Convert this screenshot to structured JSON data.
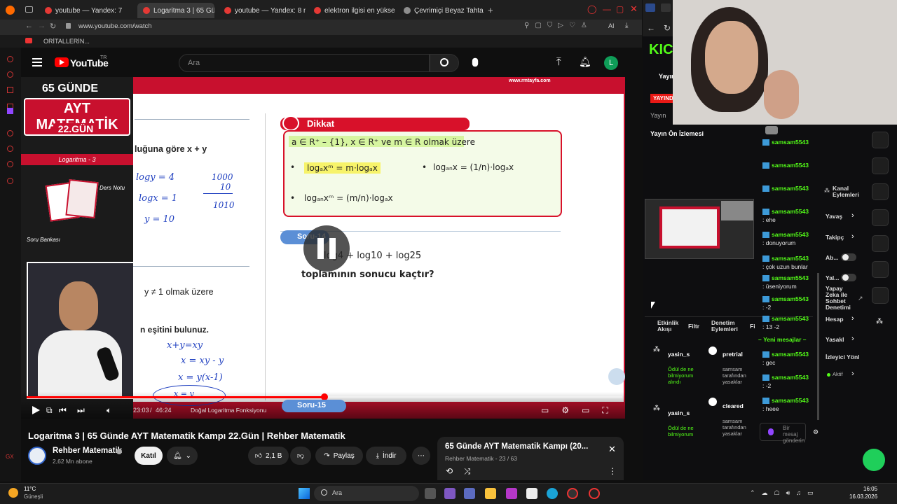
{
  "browser": {
    "tabs": [
      {
        "label": "youtube — Yandex: 7 milyo"
      },
      {
        "label": "Logaritma 3 | 65 Günd"
      },
      {
        "label": "youtube — Yandex: 8 milyo"
      },
      {
        "label": "elektron ilgisi en yüksek ve"
      },
      {
        "label": "Çevrimiçi Beyaz Tahta - Ç"
      }
    ],
    "url": "www.youtube.com/watch",
    "bookmark": "ORİTALLERİN..."
  },
  "youtube": {
    "logo": "YouTube",
    "region": "TR",
    "search_placeholder": "Ara",
    "avatar_letter": "L"
  },
  "video": {
    "badge_top": "65 GÜNDE",
    "badge_main": "AYT MATEMATİK",
    "badge_day": "22.GÜN",
    "topic": "Logaritma - 3",
    "ders_notu": "Ders Notu",
    "soru_bankasi": "Soru Bankası",
    "site": "www.rmtayfa.com",
    "dikkat_title": "Dikkat",
    "cond_line": "a ∈ R⁺ – {1},  x ∈ R⁺ ve m ∈ R olmak üzere",
    "rule1": "logₐxᵐ = m·logₐx",
    "rule2": "logₐₙx = (1/n)·logₐx",
    "rule3": "logₐₙxᵐ = (m/n)·logₐx",
    "frac1_num": "1",
    "frac1_den": "n",
    "frac2_num": "m",
    "frac2_den": "n",
    "left_text1": "luğuna göre x + y",
    "left_text2": "y ≠ 1 olmak üzere",
    "left_text3": "n eşitini bulunuz.",
    "question_label": "Soru-14",
    "question_expr": "log4 + log10 + log25",
    "question_text": "toplamının sonucu kaçtır?",
    "next_label": "Soru-15",
    "handwriting": [
      "logy = 4",
      "logx = 1",
      "y = 10",
      "1000",
      "10",
      "1010",
      "x+y=xy",
      "x = xy - y",
      "x = y(x-1)",
      "x = y",
      "x-1"
    ],
    "time_current": "23:03",
    "time_total": "46:24",
    "chapter": "Doğal Logaritma Fonksiyonu",
    "progress": 0.5
  },
  "meta": {
    "title": "Logaritma 3 | 65 Günde AYT Matematik Kampı 22.Gün | Rehber Matematik",
    "channel": "Rehber Matematik",
    "subs": "2,62 Mn abone",
    "join": "Katıl",
    "likes": "2,1 B",
    "share": "Paylaş",
    "download": "İndir",
    "playlist_title": "65 Günde AYT Matematik Kampı (20...",
    "playlist_sub": "Rehber Matematik - 23 / 63"
  },
  "stream": {
    "logo": "KIC",
    "yayin_label": "Yayın",
    "live_badge": "YAYINDA",
    "yayin2": "Yayın",
    "preview_title": "Yayın Ön İzlemesi",
    "activity_title": "Etkinlik Akışı",
    "filter1": "Filtr",
    "moderation_title": "Denetim Eylemleri",
    "filter2": "Fi",
    "activity_items": [
      {
        "user": "yasin_s",
        "desc": "Ödül de ne bilmiyorum alındı"
      },
      {
        "user": "yasin_s",
        "desc": "Ödül de ne bilmiyorum"
      }
    ],
    "moderation_items": [
      {
        "action": "pretrial",
        "desc": "samsam tarafından yasaklar"
      },
      {
        "action": "cleared",
        "desc": "samsam tarafından yasaklar"
      }
    ],
    "chat": [
      {
        "user": "samsam5543",
        "msg": ""
      },
      {
        "user": "samsam5543",
        "msg": ""
      },
      {
        "user": "samsam5543",
        "msg": ""
      },
      {
        "user": "samsam5543",
        "msg": ": ehe"
      },
      {
        "user": "samsam5543",
        "msg": ": donuyorum"
      },
      {
        "user": "samsam5543",
        "msg": ": çok uzun bunlar"
      },
      {
        "user": "samsam5543",
        "msg": ": üseniyorum"
      },
      {
        "user": "samsam5543",
        "msg": ": -2"
      },
      {
        "user": "samsam5543",
        "msg": ": 13 -2"
      }
    ],
    "new_messages": "Yeni mesajlar",
    "chat2": [
      {
        "user": "samsam5543",
        "msg": ": gec"
      },
      {
        "user": "samsam5543",
        "msg": ": -2"
      },
      {
        "user": "samsam5543",
        "msg": ": heee"
      }
    ],
    "send_placeholder": "Bir mesaj gönderin",
    "channel_actions": "Kanal Eylemleri",
    "actions": [
      "Yavaş",
      "Takipç",
      "Ab...",
      "Yal...",
      "Yapay Zeka ile Sohbet Denetimi",
      "Hesap",
      "Yasakl",
      "İzleyici Yönl"
    ],
    "active": "Aktif"
  },
  "taskbar": {
    "weather_temp": "11°C",
    "weather_desc": "Güneşli",
    "search": "Ara",
    "time": "16:05",
    "date": "16.03.2026"
  }
}
